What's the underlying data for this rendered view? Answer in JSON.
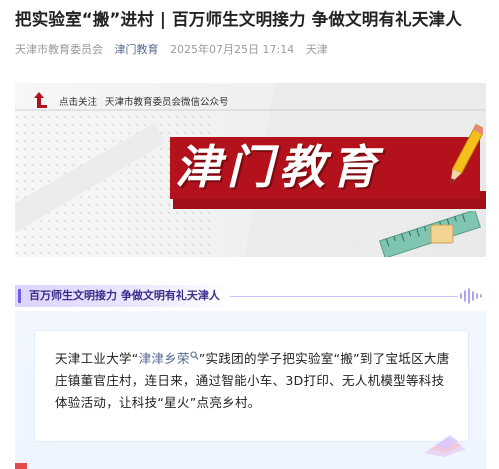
{
  "article": {
    "title": "把实验室“搬”进村 | 百万师生文明接力 争做文明有礼天津人",
    "author": "天津市教育委员会",
    "account": "津门教育",
    "datetime": "2025年07月25日 17:14",
    "location": "天津"
  },
  "banner": {
    "follow_hint": "点击关注",
    "follow_target": "天津市教育委员会微信公众号",
    "big_title": "津门教育",
    "icons": [
      "back-arrow-icon",
      "pencil-icon",
      "ruler-icon",
      "eraser-icon"
    ],
    "colors": {
      "red": "#b3111b",
      "pencil_yellow": "#f5c01c",
      "ruler_green": "#6dbfa8"
    }
  },
  "section": {
    "header": "百万师生文明接力 争做文明有礼天津人",
    "icon": "sound-wave-icon",
    "accent": "#6c5ce7"
  },
  "content": {
    "p1_before": "天津工业大学“",
    "p1_link": "津津乡荣",
    "p1_after": "”实践团的学子把实验室“搬”到了宝坻区大唐庄镇董官庄村，连日来，通过智能小车、3D打印、无人机模型等科技体验活动，让科技“星火”点亮乡村。",
    "link_icon": "search-icon",
    "link_color": "#576b95"
  }
}
